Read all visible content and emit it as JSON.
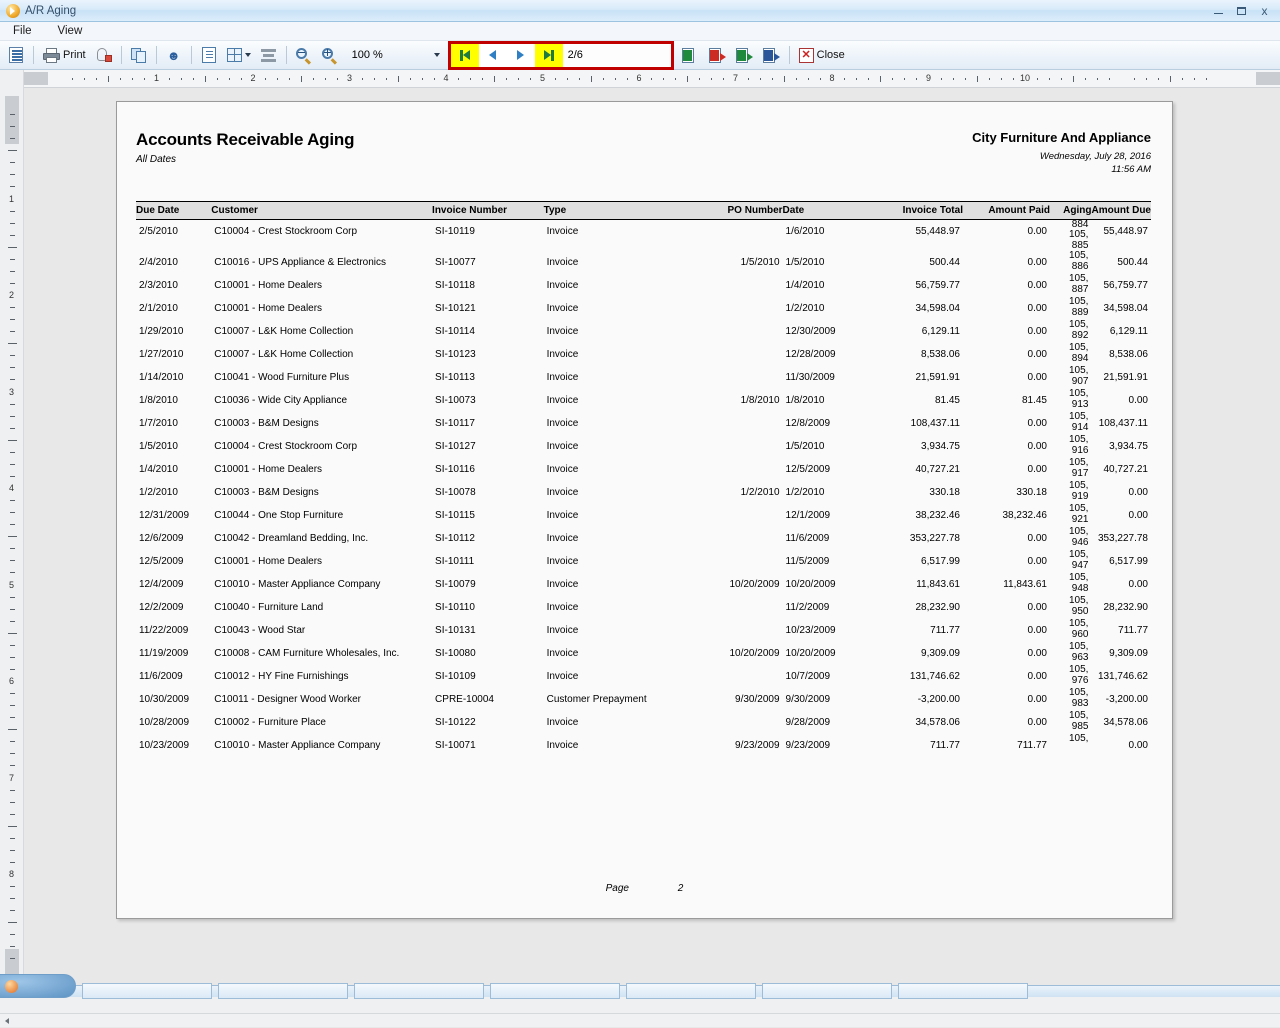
{
  "window": {
    "title": "A/R Aging",
    "app_icon": "orange-play-icon",
    "minimize_label": "–",
    "maximize_label": "❐",
    "close_label": "✕"
  },
  "menu": {
    "items": [
      {
        "label": "File"
      },
      {
        "label": "View"
      }
    ]
  },
  "toolbar": {
    "buttons": [
      {
        "name": "report-view-button",
        "icon": "report-document-icon",
        "label": ""
      },
      {
        "name": "print-button",
        "icon": "printer-icon",
        "label": "Print"
      },
      {
        "name": "print-preview-attach-button",
        "icon": "paperclip-page-icon",
        "label": ""
      },
      {
        "name": "copy-button",
        "icon": "copy-pages-icon",
        "label": ""
      },
      {
        "name": "find-button",
        "icon": "binoculars-icon",
        "label": ""
      },
      {
        "name": "single-page-button",
        "icon": "single-page-icon",
        "label": ""
      },
      {
        "name": "multi-page-button",
        "icon": "multi-page-grid-icon",
        "label": ""
      },
      {
        "name": "page-width-button",
        "icon": "page-width-lines-icon",
        "label": ""
      },
      {
        "name": "zoom-out-button",
        "icon": "zoom-out-icon",
        "label": ""
      },
      {
        "name": "zoom-in-button",
        "icon": "zoom-in-icon",
        "label": ""
      }
    ],
    "zoom": {
      "value": "100 %",
      "dropdown_icon": "chevron-down-icon"
    },
    "navigation": {
      "first_page_icon": "first-page-icon",
      "previous_page_icon": "previous-page-icon",
      "next_page_icon": "next-page-icon",
      "last_page_icon": "last-page-icon",
      "page_indicator": "2/6",
      "highlight_color": "#c00000",
      "active_button_color": "#ffff00"
    },
    "exports": [
      {
        "name": "export-excel-data-button",
        "icon": "excel-grid-icon"
      },
      {
        "name": "export-pdf-button",
        "icon": "pdf-export-icon"
      },
      {
        "name": "export-excel-button",
        "icon": "excel-export-icon"
      },
      {
        "name": "export-word-button",
        "icon": "word-export-icon"
      }
    ],
    "close": {
      "label": "Close",
      "icon": "red-x-icon"
    }
  },
  "rulers": {
    "horizontal_numbers": [
      "1",
      "2",
      "3",
      "4",
      "5",
      "6",
      "7",
      "8",
      "9",
      "10"
    ],
    "vertical_numbers": [
      "1",
      "2",
      "3",
      "4",
      "5",
      "6",
      "7",
      "8"
    ]
  },
  "report": {
    "title": "Accounts Receivable Aging",
    "subtitle": "All Dates",
    "company": "City Furniture And Appliance",
    "date": "Wednesday, July 28, 2016",
    "time": "11:56 AM",
    "columns": [
      {
        "key": "due_date",
        "label": "Due Date",
        "align": "left"
      },
      {
        "key": "customer",
        "label": "Customer",
        "align": "left"
      },
      {
        "key": "invoice_number",
        "label": "Invoice Number",
        "align": "left"
      },
      {
        "key": "type",
        "label": "Type",
        "align": "left"
      },
      {
        "key": "po_number",
        "label": "PO Number",
        "align": "right"
      },
      {
        "key": "date",
        "label": "Date",
        "align": "left"
      },
      {
        "key": "invoice_total",
        "label": "Invoice Total",
        "align": "right"
      },
      {
        "key": "amount_paid",
        "label": "Amount Paid",
        "align": "right"
      },
      {
        "key": "aging",
        "label": "Aging",
        "align": "right"
      },
      {
        "key": "amount_due",
        "label": "Amount Due",
        "align": "right"
      }
    ],
    "aging_overflow_top": "884",
    "rows": [
      {
        "due_date": "2/5/2010",
        "customer": "C10004 - Crest Stockroom Corp",
        "invoice_number": "SI-10119",
        "type": "Invoice",
        "po_number": "",
        "date": "1/6/2010",
        "invoice_total": "55,448.97",
        "amount_paid": "0.00",
        "aging_1": "105,",
        "aging_2": "885",
        "amount_due": "55,448.97"
      },
      {
        "due_date": "2/4/2010",
        "customer": "C10016 - UPS Appliance & Electronics",
        "invoice_number": "SI-10077",
        "type": "Invoice",
        "po_number": "1/5/2010",
        "date": "1/5/2010",
        "invoice_total": "500.44",
        "amount_paid": "0.00",
        "aging_1": "105,",
        "aging_2": "886",
        "amount_due": "500.44"
      },
      {
        "due_date": "2/3/2010",
        "customer": "C10001 - Home Dealers",
        "invoice_number": "SI-10118",
        "type": "Invoice",
        "po_number": "",
        "date": "1/4/2010",
        "invoice_total": "56,759.77",
        "amount_paid": "0.00",
        "aging_1": "105,",
        "aging_2": "887",
        "amount_due": "56,759.77"
      },
      {
        "due_date": "2/1/2010",
        "customer": "C10001 - Home Dealers",
        "invoice_number": "SI-10121",
        "type": "Invoice",
        "po_number": "",
        "date": "1/2/2010",
        "invoice_total": "34,598.04",
        "amount_paid": "0.00",
        "aging_1": "105,",
        "aging_2": "889",
        "amount_due": "34,598.04"
      },
      {
        "due_date": "1/29/2010",
        "customer": "C10007 - L&K Home Collection",
        "invoice_number": "SI-10114",
        "type": "Invoice",
        "po_number": "",
        "date": "12/30/2009",
        "invoice_total": "6,129.11",
        "amount_paid": "0.00",
        "aging_1": "105,",
        "aging_2": "892",
        "amount_due": "6,129.11"
      },
      {
        "due_date": "1/27/2010",
        "customer": "C10007 - L&K Home Collection",
        "invoice_number": "SI-10123",
        "type": "Invoice",
        "po_number": "",
        "date": "12/28/2009",
        "invoice_total": "8,538.06",
        "amount_paid": "0.00",
        "aging_1": "105,",
        "aging_2": "894",
        "amount_due": "8,538.06"
      },
      {
        "due_date": "1/14/2010",
        "customer": "C10041 - Wood Furniture Plus",
        "invoice_number": "SI-10113",
        "type": "Invoice",
        "po_number": "",
        "date": "11/30/2009",
        "invoice_total": "21,591.91",
        "amount_paid": "0.00",
        "aging_1": "105,",
        "aging_2": "907",
        "amount_due": "21,591.91"
      },
      {
        "due_date": "1/8/2010",
        "customer": "C10036 - Wide City Appliance",
        "invoice_number": "SI-10073",
        "type": "Invoice",
        "po_number": "1/8/2010",
        "date": "1/8/2010",
        "invoice_total": "81.45",
        "amount_paid": "81.45",
        "aging_1": "105,",
        "aging_2": "913",
        "amount_due": "0.00"
      },
      {
        "due_date": "1/7/2010",
        "customer": "C10003 - B&M Designs",
        "invoice_number": "SI-10117",
        "type": "Invoice",
        "po_number": "",
        "date": "12/8/2009",
        "invoice_total": "108,437.11",
        "amount_paid": "0.00",
        "aging_1": "105,",
        "aging_2": "914",
        "amount_due": "108,437.11"
      },
      {
        "due_date": "1/5/2010",
        "customer": "C10004 - Crest Stockroom Corp",
        "invoice_number": "SI-10127",
        "type": "Invoice",
        "po_number": "",
        "date": "1/5/2010",
        "invoice_total": "3,934.75",
        "amount_paid": "0.00",
        "aging_1": "105,",
        "aging_2": "916",
        "amount_due": "3,934.75"
      },
      {
        "due_date": "1/4/2010",
        "customer": "C10001 - Home Dealers",
        "invoice_number": "SI-10116",
        "type": "Invoice",
        "po_number": "",
        "date": "12/5/2009",
        "invoice_total": "40,727.21",
        "amount_paid": "0.00",
        "aging_1": "105,",
        "aging_2": "917",
        "amount_due": "40,727.21"
      },
      {
        "due_date": "1/2/2010",
        "customer": "C10003 - B&M Designs",
        "invoice_number": "SI-10078",
        "type": "Invoice",
        "po_number": "1/2/2010",
        "date": "1/2/2010",
        "invoice_total": "330.18",
        "amount_paid": "330.18",
        "aging_1": "105,",
        "aging_2": "919",
        "amount_due": "0.00"
      },
      {
        "due_date": "12/31/2009",
        "customer": "C10044 - One Stop Furniture",
        "invoice_number": "SI-10115",
        "type": "Invoice",
        "po_number": "",
        "date": "12/1/2009",
        "invoice_total": "38,232.46",
        "amount_paid": "38,232.46",
        "aging_1": "105,",
        "aging_2": "921",
        "amount_due": "0.00"
      },
      {
        "due_date": "12/6/2009",
        "customer": "C10042 - Dreamland Bedding, Inc.",
        "invoice_number": "SI-10112",
        "type": "Invoice",
        "po_number": "",
        "date": "11/6/2009",
        "invoice_total": "353,227.78",
        "amount_paid": "0.00",
        "aging_1": "105,",
        "aging_2": "946",
        "amount_due": "353,227.78"
      },
      {
        "due_date": "12/5/2009",
        "customer": "C10001 - Home Dealers",
        "invoice_number": "SI-10111",
        "type": "Invoice",
        "po_number": "",
        "date": "11/5/2009",
        "invoice_total": "6,517.99",
        "amount_paid": "0.00",
        "aging_1": "105,",
        "aging_2": "947",
        "amount_due": "6,517.99"
      },
      {
        "due_date": "12/4/2009",
        "customer": "C10010 - Master Appliance Company",
        "invoice_number": "SI-10079",
        "type": "Invoice",
        "po_number": "10/20/2009",
        "date": "10/20/2009",
        "invoice_total": "11,843.61",
        "amount_paid": "11,843.61",
        "aging_1": "105,",
        "aging_2": "948",
        "amount_due": "0.00"
      },
      {
        "due_date": "12/2/2009",
        "customer": "C10040 - Furniture Land",
        "invoice_number": "SI-10110",
        "type": "Invoice",
        "po_number": "",
        "date": "11/2/2009",
        "invoice_total": "28,232.90",
        "amount_paid": "0.00",
        "aging_1": "105,",
        "aging_2": "950",
        "amount_due": "28,232.90"
      },
      {
        "due_date": "11/22/2009",
        "customer": "C10043 - Wood Star",
        "invoice_number": "SI-10131",
        "type": "Invoice",
        "po_number": "",
        "date": "10/23/2009",
        "invoice_total": "711.77",
        "amount_paid": "0.00",
        "aging_1": "105,",
        "aging_2": "960",
        "amount_due": "711.77"
      },
      {
        "due_date": "11/19/2009",
        "customer": "C10008 - CAM Furniture Wholesales, Inc.",
        "invoice_number": "SI-10080",
        "type": "Invoice",
        "po_number": "10/20/2009",
        "date": "10/20/2009",
        "invoice_total": "9,309.09",
        "amount_paid": "0.00",
        "aging_1": "105,",
        "aging_2": "963",
        "amount_due": "9,309.09"
      },
      {
        "due_date": "11/6/2009",
        "customer": "C10012 - HY Fine Furnishings",
        "invoice_number": "SI-10109",
        "type": "Invoice",
        "po_number": "",
        "date": "10/7/2009",
        "invoice_total": "131,746.62",
        "amount_paid": "0.00",
        "aging_1": "105,",
        "aging_2": "976",
        "amount_due": "131,746.62"
      },
      {
        "due_date": "10/30/2009",
        "customer": "C10011 - Designer Wood Worker",
        "invoice_number": "CPRE-10004",
        "type": "Customer Prepayment",
        "po_number": "9/30/2009",
        "date": "9/30/2009",
        "invoice_total": "-3,200.00",
        "amount_paid": "0.00",
        "aging_1": "105,",
        "aging_2": "983",
        "amount_due": "-3,200.00"
      },
      {
        "due_date": "10/28/2009",
        "customer": "C10002 - Furniture Place",
        "invoice_number": "SI-10122",
        "type": "Invoice",
        "po_number": "",
        "date": "9/28/2009",
        "invoice_total": "34,578.06",
        "amount_paid": "0.00",
        "aging_1": "105,",
        "aging_2": "985",
        "amount_due": "34,578.06"
      },
      {
        "due_date": "10/23/2009",
        "customer": "C10010 - Master Appliance Company",
        "invoice_number": "SI-10071",
        "type": "Invoice",
        "po_number": "9/23/2009",
        "date": "9/23/2009",
        "invoice_total": "711.77",
        "amount_paid": "711.77",
        "aging_1": "105,",
        "aging_2": "",
        "amount_due": "0.00"
      }
    ],
    "footer": {
      "label": "Page",
      "number": "2"
    }
  }
}
